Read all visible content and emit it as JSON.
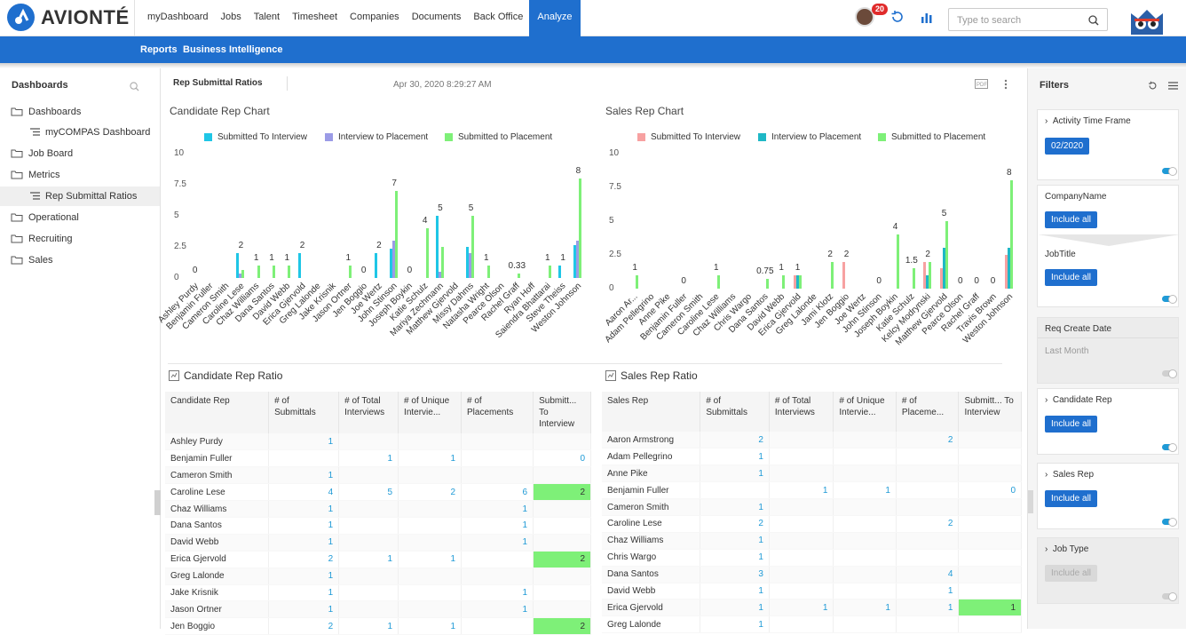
{
  "app": {
    "brand": "AVIONTÉ",
    "notif_count": "20",
    "search_placeholder": "Type to search"
  },
  "nav": {
    "items": [
      "myDashboard",
      "Jobs",
      "Talent",
      "Timesheet",
      "Companies",
      "Documents",
      "Back Office",
      "Analyze"
    ],
    "active": "Analyze"
  },
  "subnav": {
    "reports": "Reports",
    "bi": "Business Intelligence"
  },
  "sidebar": {
    "title": "Dashboards",
    "items": [
      {
        "label": "Dashboards"
      },
      {
        "label": "myCOMPAS Dashboard"
      },
      {
        "label": "Job Board"
      },
      {
        "label": "Metrics"
      },
      {
        "label": "Rep Submittal Ratios"
      },
      {
        "label": "Operational"
      },
      {
        "label": "Recruiting"
      },
      {
        "label": "Sales"
      }
    ]
  },
  "dashboard": {
    "tab_title": "Rep Submittal Ratios",
    "date": "Apr 30, 2020 8:29:27 AM"
  },
  "chart_data": [
    {
      "type": "bar",
      "title": "Candidate Rep Chart",
      "ylim": [
        0,
        10
      ],
      "yticks": [
        "10",
        "7.5",
        "5",
        "2.5",
        "0"
      ],
      "series": [
        {
          "name": "Submitted To Interview",
          "color": "#1fc6e6"
        },
        {
          "name": "Interview to Placement",
          "color": "#9b9be6"
        },
        {
          "name": "Submitted to Placement",
          "color": "#7ef078"
        }
      ],
      "categories": [
        "Ashley Purdy",
        "Benjamin Fuller",
        "Cameron Smith",
        "Caroline Lese",
        "Chaz Williams",
        "Dana Santos",
        "David Webb",
        "Erica Gjervold",
        "Greg Lalonde",
        "Jake Krisnik",
        "Jason Ortner",
        "Jen Boggio",
        "Joe Wertz",
        "John Stinson",
        "Joseph Boykin",
        "Katie Schulz",
        "Mariya Zechmann",
        "Matthew Gjervold",
        "Missy Dahms",
        "Natasha Wright",
        "Pearce Olson",
        "Rachel Graff",
        "Ryan Hoff",
        "Saiendra Bhattarai",
        "Steve Theiss",
        "Weston Johnson"
      ],
      "values": [
        [
          null,
          null,
          0
        ],
        [
          null,
          null,
          null
        ],
        [
          null,
          null,
          null
        ],
        [
          2,
          0.33,
          0.67
        ],
        [
          null,
          null,
          1
        ],
        [
          null,
          null,
          1
        ],
        [
          0,
          null,
          1
        ],
        [
          2,
          null,
          null
        ],
        [
          null,
          null,
          null
        ],
        [
          null,
          null,
          null
        ],
        [
          0,
          null,
          1
        ],
        [
          0,
          null,
          null
        ],
        [
          2,
          null,
          null
        ],
        [
          2.33,
          3,
          7
        ],
        [
          0,
          null,
          null
        ],
        [
          0,
          null,
          4
        ],
        [
          5,
          0.5,
          2.5
        ],
        [
          null,
          null,
          null
        ],
        [
          2.5,
          2,
          5
        ],
        [
          null,
          null,
          1
        ],
        [
          null,
          null,
          null
        ],
        [
          0,
          null,
          0.33
        ],
        [
          null,
          null,
          null
        ],
        [
          0,
          null,
          1
        ],
        [
          1,
          null,
          null
        ],
        [
          2.67,
          3,
          8
        ]
      ]
    },
    {
      "type": "bar",
      "title": "Sales Rep Chart",
      "ylim": [
        0,
        10
      ],
      "yticks": [
        "10",
        "7.5",
        "5",
        "2.5",
        "0"
      ],
      "series": [
        {
          "name": "Submitted To Interview",
          "color": "#f7a1a1"
        },
        {
          "name": "Interview to Placement",
          "color": "#1fb8c6"
        },
        {
          "name": "Submitted to Placement",
          "color": "#7ef078"
        }
      ],
      "categories": [
        "Aaron Ar...",
        "Adam Pellegrino",
        "Anne Pike",
        "Benjamin Fuller",
        "Cameron Smith",
        "Caroline Lese",
        "Chaz Williams",
        "Chris Wargo",
        "Dana Santos",
        "David Webb",
        "Erica Gjervold",
        "Greg Lalonde",
        "Jami Klotz",
        "Jen Boggio",
        "Joe Wertz",
        "John Stinson",
        "Joseph Boykin",
        "Katie Schulz",
        "Kelcy Modrynski",
        "Matthew Gjervold",
        "Pearce Olson",
        "Rachel Graff",
        "Travis Brown",
        "Weston Johnson"
      ],
      "values": [
        [
          0,
          null,
          1
        ],
        [
          null,
          null,
          null
        ],
        [
          null,
          null,
          null
        ],
        [
          0,
          null,
          null
        ],
        [
          null,
          null,
          null
        ],
        [
          0,
          null,
          1
        ],
        [
          null,
          null,
          null
        ],
        [
          null,
          null,
          null
        ],
        [
          null,
          null,
          0.75
        ],
        [
          0,
          null,
          1
        ],
        [
          1,
          1,
          1
        ],
        [
          null,
          null,
          null
        ],
        [
          0,
          null,
          2
        ],
        [
          2,
          null,
          null
        ],
        [
          null,
          null,
          null
        ],
        [
          0,
          null,
          null
        ],
        [
          0,
          null,
          4
        ],
        [
          0,
          null,
          1.5
        ],
        [
          2,
          1,
          2
        ],
        [
          1.5,
          3,
          5
        ],
        [
          0,
          null,
          null
        ],
        [
          0,
          null,
          null
        ],
        [
          0,
          null,
          null
        ],
        [
          2.5,
          3,
          8
        ]
      ]
    }
  ],
  "cand_ratio": {
    "title": "Candidate Rep Ratio",
    "headers": [
      "Candidate Rep",
      "# of Submittals",
      "# of Total Interviews",
      "# of Unique Intervie...",
      "# of Placements",
      "Submitt... To Interview"
    ],
    "rows": [
      [
        "Ashley Purdy",
        "1",
        "",
        "",
        "",
        ""
      ],
      [
        "Benjamin Fuller",
        "",
        "1",
        "1",
        "",
        "0"
      ],
      [
        "Cameron Smith",
        "1",
        "",
        "",
        "",
        ""
      ],
      [
        "Caroline Lese",
        "4",
        "5",
        "2",
        "6",
        "2"
      ],
      [
        "Chaz Williams",
        "1",
        "",
        "",
        "1",
        ""
      ],
      [
        "Dana Santos",
        "1",
        "",
        "",
        "1",
        ""
      ],
      [
        "David Webb",
        "1",
        "",
        "",
        "1",
        ""
      ],
      [
        "Erica Gjervold",
        "2",
        "1",
        "1",
        "",
        "2"
      ],
      [
        "Greg Lalonde",
        "1",
        "",
        "",
        "",
        ""
      ],
      [
        "Jake Krisnik",
        "1",
        "",
        "",
        "1",
        ""
      ],
      [
        "Jason Ortner",
        "1",
        "",
        "",
        "1",
        ""
      ],
      [
        "Jen Boggio",
        "2",
        "1",
        "1",
        "",
        "2"
      ]
    ],
    "highlight_rows": [
      3,
      7,
      11
    ]
  },
  "sales_ratio": {
    "title": "Sales Rep Ratio",
    "headers": [
      "Sales Rep",
      "# of Submittals",
      "# of Total Interviews",
      "# of Unique Intervie...",
      "# of Placeme...",
      "Submitt... To Interview"
    ],
    "rows": [
      [
        "Aaron Armstrong",
        "2",
        "",
        "",
        "2",
        ""
      ],
      [
        "Adam Pellegrino",
        "1",
        "",
        "",
        "",
        ""
      ],
      [
        "Anne Pike",
        "1",
        "",
        "",
        "",
        ""
      ],
      [
        "Benjamin Fuller",
        "",
        "1",
        "1",
        "",
        "0"
      ],
      [
        "Cameron Smith",
        "1",
        "",
        "",
        "",
        ""
      ],
      [
        "Caroline Lese",
        "2",
        "",
        "",
        "2",
        ""
      ],
      [
        "Chaz Williams",
        "1",
        "",
        "",
        "",
        ""
      ],
      [
        "Chris Wargo",
        "1",
        "",
        "",
        "",
        ""
      ],
      [
        "Dana Santos",
        "3",
        "",
        "",
        "4",
        ""
      ],
      [
        "David Webb",
        "1",
        "",
        "",
        "1",
        ""
      ],
      [
        "Erica Gjervold",
        "1",
        "1",
        "1",
        "1",
        "1"
      ],
      [
        "Greg Lalonde",
        "1",
        "",
        "",
        "",
        ""
      ]
    ],
    "highlight_rows": [
      10
    ]
  },
  "filters": {
    "title": "Filters",
    "activity": "Activity Time Frame",
    "activity_value": "02/2020",
    "company": "CompanyName",
    "include_all": "Include all",
    "jobtitle": "JobTitle",
    "req_date": "Req Create Date",
    "req_value": "Last Month",
    "cand_rep": "Candidate Rep",
    "sales_rep": "Sales Rep",
    "job_type": "Job Type"
  }
}
